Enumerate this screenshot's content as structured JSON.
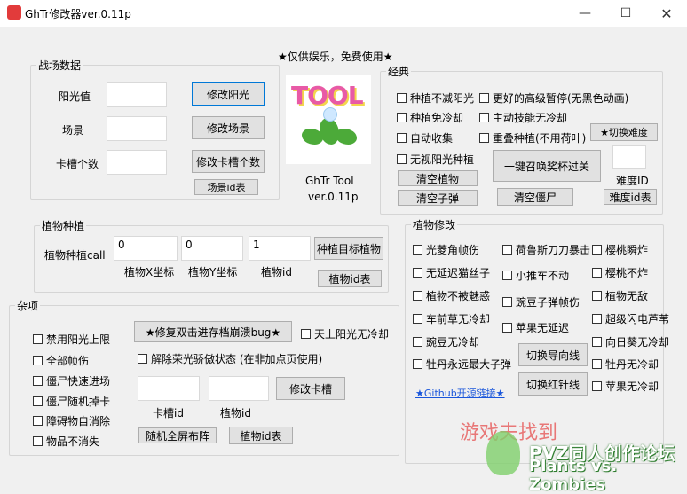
{
  "window": {
    "title": "GhTr修改器ver.0.11p"
  },
  "header_text": "★仅供娱乐，免费使用★",
  "logo": {
    "word": "TOOL",
    "name": "GhTr Tool",
    "version": "ver.0.11p"
  },
  "battle": {
    "title": "战场数据",
    "sun_label": "阳光值",
    "scene_label": "场景",
    "slots_label": "卡槽个数",
    "sun_value": "",
    "scene_value": "",
    "slots_value": "",
    "btn_sun": "修改阳光",
    "btn_scene": "修改场景",
    "btn_slots": "修改卡槽个数",
    "btn_scene_table": "场景id表"
  },
  "classic": {
    "title": "经典",
    "checks": [
      "种植不减阳光",
      "更好的高级暂停(无黑色动画)",
      "种植免冷却",
      "主动技能无冷却",
      "自动收集",
      "重叠种植(不用荷叶)",
      "无视阳光种植"
    ],
    "btn_switch_diff": "★切换难度",
    "btn_summon": "一键召唤奖杯过关",
    "btn_clear_plants": "清空植物",
    "btn_clear_bullets": "清空子弹",
    "btn_clear_zombies": "清空僵尸",
    "difficulty_label": "难度ID",
    "difficulty_value": "",
    "btn_diff_table": "难度id表"
  },
  "plant_place": {
    "title": "植物种植",
    "call_label": "植物种植call",
    "x_value": "0",
    "y_value": "0",
    "id_value": "1",
    "x_label": "植物X坐标",
    "y_label": "植物Y坐标",
    "id_label": "植物id",
    "btn_plant_target": "种植目标植物",
    "btn_plant_table": "植物id表"
  },
  "plant_mod": {
    "title": "植物修改",
    "checks": [
      "光菱角帧伤",
      "荷鲁斯刀刀暴击",
      "樱桃瞬炸",
      "无延迟猫丝子",
      "小推车不动",
      "樱桃不炸",
      "植物不被魅惑",
      "豌豆子弹帧伤",
      "植物无敌",
      "车前草无冷却",
      "苹果无延迟",
      "超级闪电芦苇",
      "豌豆无冷却",
      "向日葵无冷却",
      "牡丹永远最大子弹",
      "牡丹无冷却",
      "苹果无冷却"
    ],
    "btn_switch_guide": "切换导向线",
    "btn_switch_red": "切换红针线",
    "github_link": "★Github开源链接★"
  },
  "misc": {
    "title": "杂项",
    "checks": [
      "禁用阳光上限",
      "全部帧伤",
      "僵尸快速进场",
      "僵尸随机掉卡",
      "障碍物自消除",
      "物品不消失"
    ],
    "btn_fix_bug": "★修复双击进存档崩溃bug★",
    "chk_sky_sun": "天上阳光无冷却",
    "chk_release_glory": "解除荣光骄傲状态 (在非加点页使用)",
    "card_id_label": "卡槽id",
    "plant_id_label": "植物id",
    "card_id_value": "",
    "plant_id_value": "",
    "btn_modify_card": "修改卡槽",
    "btn_random_layout": "随机全屏布阵",
    "btn_plant_table": "植物id表"
  },
  "watermark": {
    "line1": "游戏夫找到",
    "line2": "PVZ同人创作论坛",
    "line3": "Plants vs. Zombies"
  },
  "colors": {
    "link": "#1a56db",
    "logo_pink": "#e85aa6",
    "accent_border": "#0078d7"
  }
}
